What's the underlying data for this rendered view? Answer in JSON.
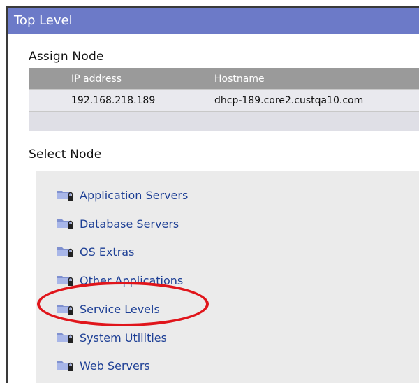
{
  "window": {
    "title": "Top Level"
  },
  "assign_node": {
    "heading": "Assign Node",
    "columns": [
      "",
      "IP address",
      "Hostname"
    ],
    "rows": [
      {
        "ip": "192.168.218.189",
        "hostname": "dhcp-189.core2.custqa10.com"
      }
    ]
  },
  "select_node": {
    "heading": "Select Node",
    "items": [
      {
        "label": "Application Servers",
        "icon": "locked-folder-icon"
      },
      {
        "label": "Database Servers",
        "icon": "locked-folder-icon"
      },
      {
        "label": "OS Extras",
        "icon": "locked-folder-icon"
      },
      {
        "label": "Other Applications",
        "icon": "locked-folder-icon"
      },
      {
        "label": "Service Levels",
        "icon": "locked-folder-icon",
        "highlighted": true
      },
      {
        "label": "System Utilities",
        "icon": "locked-folder-icon"
      },
      {
        "label": "Web Servers",
        "icon": "locked-folder-icon"
      }
    ]
  },
  "colors": {
    "titlebar": "#6c7ac8",
    "link": "#1d3f95",
    "highlight": "#e0151b"
  }
}
